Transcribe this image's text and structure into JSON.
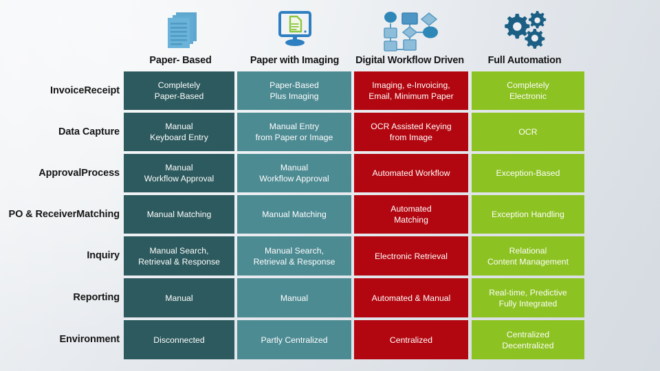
{
  "header": {
    "columns": [
      {
        "label": "Paper- Based",
        "icon": "paper-stack-icon"
      },
      {
        "label": "Paper with Imaging",
        "icon": "monitor-document-icon"
      },
      {
        "label": "Digital Workflow Driven",
        "icon": "flowchart-icon"
      },
      {
        "label": "Full Automation",
        "icon": "gears-icon"
      }
    ]
  },
  "colors": {
    "col0": "#2d5a5e",
    "col1": "#4d8b93",
    "col2": "#b20710",
    "col3": "#8cc221",
    "icon_light_blue": "#6bafd6",
    "icon_blue": "#2e7fc1",
    "icon_green": "#8cc63f",
    "icon_dark_blue": "#1c5f85",
    "label_text": "#151515",
    "cell_text": "#ffffff"
  },
  "rows": [
    {
      "label": "Invoice Receipt",
      "label_lines": [
        "Invoice",
        "Receipt"
      ],
      "cells": [
        [
          "Completely",
          "Paper-Based"
        ],
        [
          "Paper-Based",
          "Plus Imaging"
        ],
        [
          "Imaging, e-Invoicing,",
          "Email, Minimum Paper"
        ],
        [
          "Completely",
          "Electronic"
        ]
      ]
    },
    {
      "label": "Data Capture",
      "label_lines": [
        "Data Capture"
      ],
      "cells": [
        [
          "Manual",
          "Keyboard Entry"
        ],
        [
          "Manual  Entry",
          "from Paper or Image"
        ],
        [
          "OCR Assisted Keying",
          "from Image"
        ],
        [
          "OCR"
        ]
      ]
    },
    {
      "label": "Approval Process",
      "label_lines": [
        "Approval",
        "Process"
      ],
      "cells": [
        [
          "Manual",
          "Workflow Approval"
        ],
        [
          "Manual",
          "Workflow Approval"
        ],
        [
          "Automated Workflow"
        ],
        [
          "Exception-Based"
        ]
      ]
    },
    {
      "label": "PO & Receiver Matching",
      "label_lines": [
        "PO & Receiver",
        "Matching"
      ],
      "cells": [
        [
          "Manual Matching"
        ],
        [
          "Manual Matching"
        ],
        [
          "Automated",
          "Matching"
        ],
        [
          "Exception Handling"
        ]
      ]
    },
    {
      "label": "Inquiry",
      "label_lines": [
        "Inquiry"
      ],
      "cells": [
        [
          "Manual Search,",
          "Retrieval & Response"
        ],
        [
          "Manual Search,",
          "Retrieval & Response"
        ],
        [
          "Electronic Retrieval"
        ],
        [
          "Relational",
          "Content Management"
        ]
      ]
    },
    {
      "label": "Reporting",
      "label_lines": [
        "Reporting"
      ],
      "cells": [
        [
          "Manual"
        ],
        [
          "Manual"
        ],
        [
          "Automated & Manual"
        ],
        [
          "Real-time, Predictive",
          "Fully Integrated"
        ]
      ]
    },
    {
      "label": "Environment",
      "label_lines": [
        "Environment"
      ],
      "cells": [
        [
          "Disconnected"
        ],
        [
          "Partly Centralized"
        ],
        [
          "Centralized"
        ],
        [
          "Centralized",
          "Decentralized"
        ]
      ]
    }
  ]
}
